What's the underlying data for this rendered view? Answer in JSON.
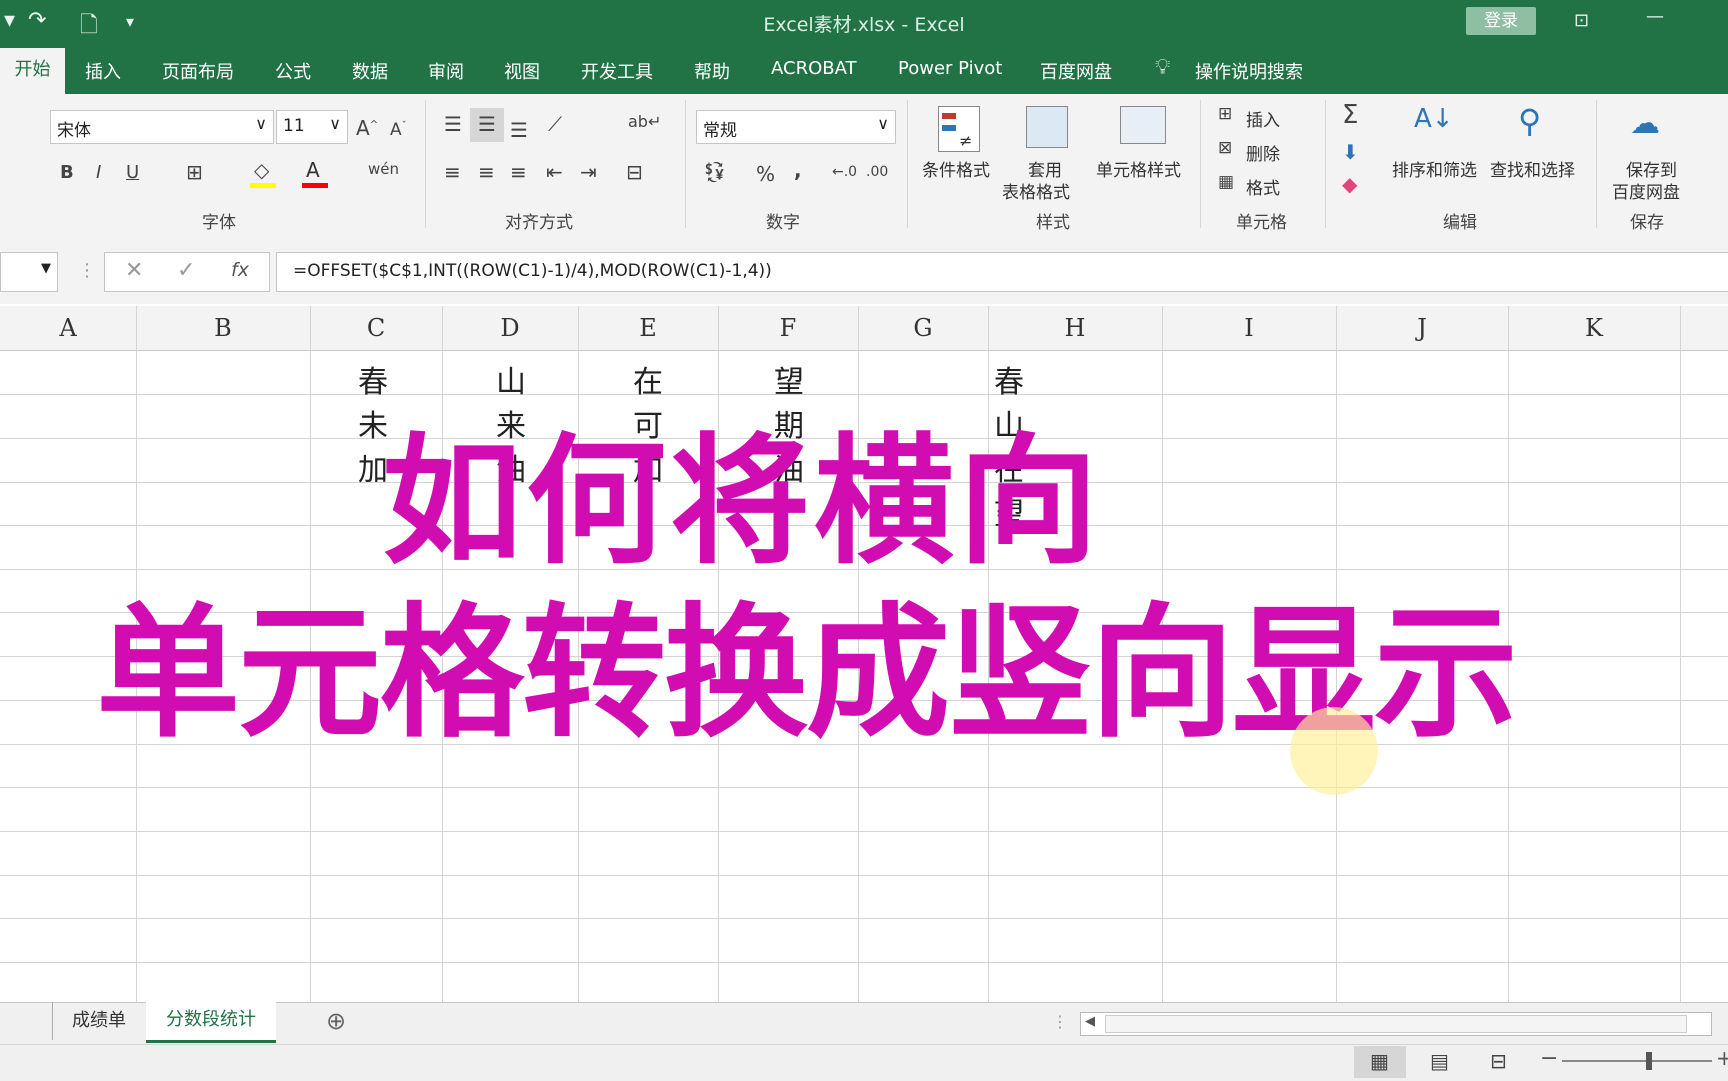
{
  "window": {
    "title": "Excel素材.xlsx  -  Excel",
    "login": "登录"
  },
  "tabs": [
    "开始",
    "插入",
    "页面布局",
    "公式",
    "数据",
    "审阅",
    "视图",
    "开发工具",
    "帮助",
    "ACROBAT",
    "Power Pivot",
    "百度网盘",
    "操作说明搜索"
  ],
  "ribbon": {
    "font_name": "宋体",
    "font_size": "11",
    "number_format": "常规",
    "group_labels": {
      "font": "字体",
      "align": "对齐方式",
      "number": "数字",
      "styles": "样式",
      "cells": "单元格",
      "edit": "编辑",
      "save": "保存"
    },
    "styles": {
      "cond": "条件格式",
      "table1": "套用",
      "table2": "表格格式",
      "cell_style": "单元格样式"
    },
    "cells": {
      "insert": "插入",
      "delete": "删除",
      "format": "格式"
    },
    "edit": {
      "sort": "排序和筛选",
      "find": "查找和选择"
    },
    "save": {
      "l1": "保存到",
      "l2": "百度网盘"
    },
    "buttons": {
      "bold": "B",
      "italic": "I",
      "underline": "U",
      "percent": "%",
      "comma": ",",
      "sum": "Σ"
    }
  },
  "formula_bar": {
    "fx": "fx",
    "formula": "=OFFSET($C$1,INT((ROW(C1)-1)/4),MOD(ROW(C1)-1,4))"
  },
  "columns": [
    "A",
    "B",
    "C",
    "D",
    "E",
    "F",
    "G",
    "H",
    "I",
    "J",
    "K"
  ],
  "cells": {
    "C1": "春",
    "D1": "山",
    "E1": "在",
    "F1": "望",
    "H1": "春",
    "C2": "未",
    "D2": "来",
    "E2": "可",
    "F2": "期",
    "H2": "山",
    "C3": "加",
    "D3": "油",
    "E3": "加",
    "F3": "油",
    "H3": "在",
    "H4": "望"
  },
  "overlay": {
    "line1": "如何将横向",
    "line2": "单元格转换成竖向显示",
    "color": "#d10cb0"
  },
  "sheets": [
    "成绩单",
    "分数段统计"
  ],
  "colors": {
    "excel_green": "#217346"
  }
}
